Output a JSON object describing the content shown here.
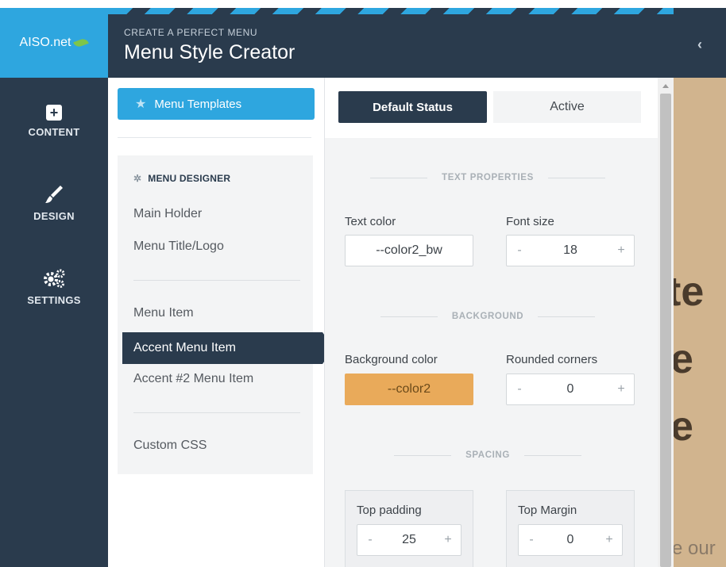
{
  "app": {
    "logo_text": "AISO.net",
    "subtitle": "CREATE A PERFECT MENU",
    "title": "Menu Style Creator",
    "collapse_glyph": "‹"
  },
  "sidebar": {
    "items": [
      {
        "label": "CONTENT",
        "icon": "plus-square-icon"
      },
      {
        "label": "DESIGN",
        "icon": "brush-icon"
      },
      {
        "label": "SETTINGS",
        "icon": "gears-icon"
      }
    ]
  },
  "menu_column": {
    "templates_button": "Menu Templates",
    "designer_heading": "MENU DESIGNER",
    "items": {
      "main_holder": "Main Holder",
      "menu_title_logo": "Menu Title/Logo",
      "menu_item": "Menu Item",
      "accent_menu_item": "Accent Menu Item",
      "accent2_menu_item": "Accent #2 Menu Item",
      "custom_css": "Custom CSS"
    },
    "selected": "Accent Menu Item"
  },
  "properties": {
    "tabs": {
      "default": "Default Status",
      "active": "Active"
    },
    "selected_tab": "Default Status",
    "text_section": "TEXT PROPERTIES",
    "text_color_label": "Text color",
    "text_color_value": "--color2_bw",
    "font_size_label": "Font size",
    "font_size_value": "18",
    "background_section": "BACKGROUND",
    "background_color_label": "Background color",
    "background_color_value": "--color2",
    "rounded_corners_label": "Rounded corners",
    "rounded_corners_value": "0",
    "spacing_section": "SPACING",
    "top_padding_label": "Top padding",
    "top_padding_value": "25",
    "top_margin_label": "Top Margin",
    "top_margin_value": "0",
    "minus": "-",
    "plus": "+"
  },
  "preview": {
    "fragments": [
      "te",
      "e",
      "e"
    ],
    "small_fragment": "e our"
  },
  "colors": {
    "navy": "#2a3b4d",
    "accent_blue": "#2ea6df",
    "leaf_green": "#7ec54a",
    "swatch_orange": "#e9aa5a",
    "preview_tan": "#d1b48e"
  }
}
